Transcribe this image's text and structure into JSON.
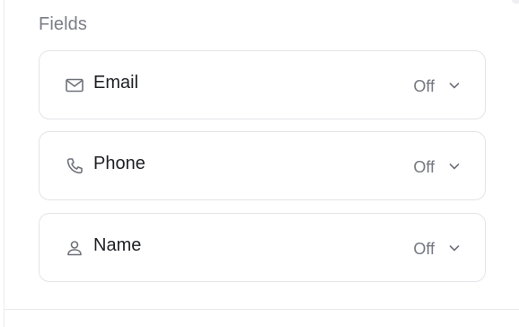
{
  "section": {
    "label": "Fields"
  },
  "fields": [
    {
      "label": "Email",
      "value": "Off",
      "icon": "mail-icon"
    },
    {
      "label": "Phone",
      "value": "Off",
      "icon": "phone-icon"
    },
    {
      "label": "Name",
      "value": "Off",
      "icon": "user-icon"
    }
  ],
  "colors": {
    "label": "#7b7d87",
    "text": "#1f2024",
    "muted": "#74767f",
    "border": "#e4e4e8"
  }
}
